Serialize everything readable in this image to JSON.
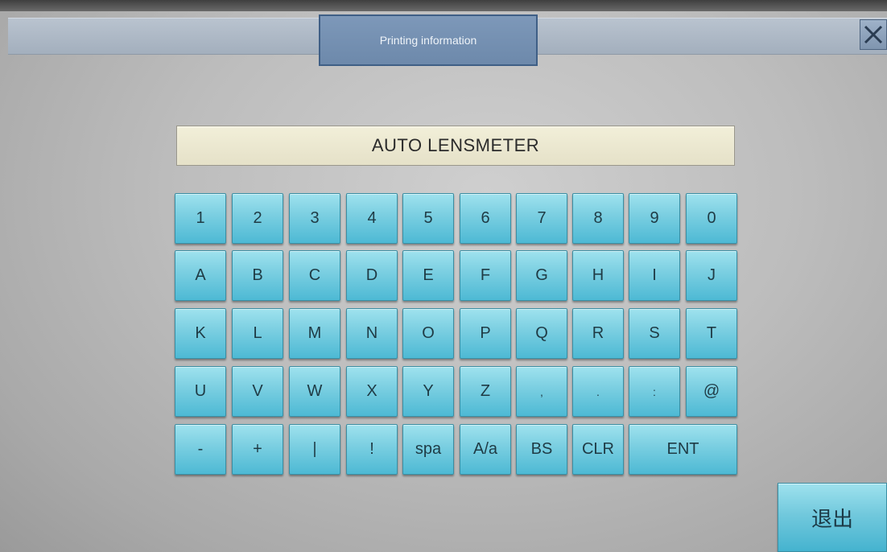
{
  "window": {
    "title": "Printing    information",
    "close_icon": "close-icon"
  },
  "display": {
    "text": "AUTO LENSMETER"
  },
  "keyboard": {
    "rows": [
      [
        "1",
        "2",
        "3",
        "4",
        "5",
        "6",
        "7",
        "8",
        "9",
        "0"
      ],
      [
        "A",
        "B",
        "C",
        "D",
        "E",
        "F",
        "G",
        "H",
        "I",
        "J"
      ],
      [
        "K",
        "L",
        "M",
        "N",
        "O",
        "P",
        "Q",
        "R",
        "S",
        "T"
      ],
      [
        "U",
        "V",
        "W",
        "X",
        "Y",
        "Z",
        ",",
        ".",
        ":",
        "@"
      ],
      [
        "-",
        "+",
        "|",
        "!",
        "spa",
        "A/a",
        "BS",
        "CLR",
        "ENT"
      ]
    ]
  },
  "exit_button": {
    "label": "退出"
  },
  "colors": {
    "key_top": "#9fe2ee",
    "key_bottom": "#4db9d4",
    "display_bg": "#f2efd9",
    "title_tab": "#7d98b9"
  }
}
